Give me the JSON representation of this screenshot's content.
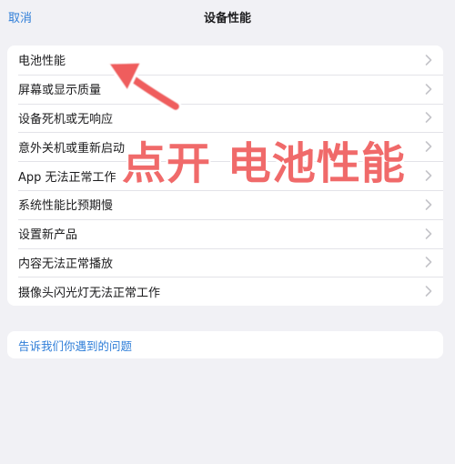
{
  "nav": {
    "cancel_label": "取消",
    "title": "设备性能"
  },
  "options": [
    {
      "label": "电池性能"
    },
    {
      "label": "屏幕或显示质量"
    },
    {
      "label": "设备死机或无响应"
    },
    {
      "label": "意外关机或重新启动"
    },
    {
      "label": "App 无法正常工作"
    },
    {
      "label": "系统性能比预期慢"
    },
    {
      "label": "设置新产品"
    },
    {
      "label": "内容无法正常播放"
    },
    {
      "label": "摄像头闪光灯无法正常工作"
    }
  ],
  "report": {
    "label": "告诉我们你遇到的问题"
  },
  "annotation": {
    "text": "点开 电池性能",
    "color": "#f06a6a"
  },
  "colors": {
    "accent": "#2f7ed8",
    "background": "#f1f1f5",
    "chevron": "#c4c4c9"
  },
  "icons": {
    "row_chevron": "chevron-right-icon",
    "annotation_arrow": "arrow-icon"
  }
}
